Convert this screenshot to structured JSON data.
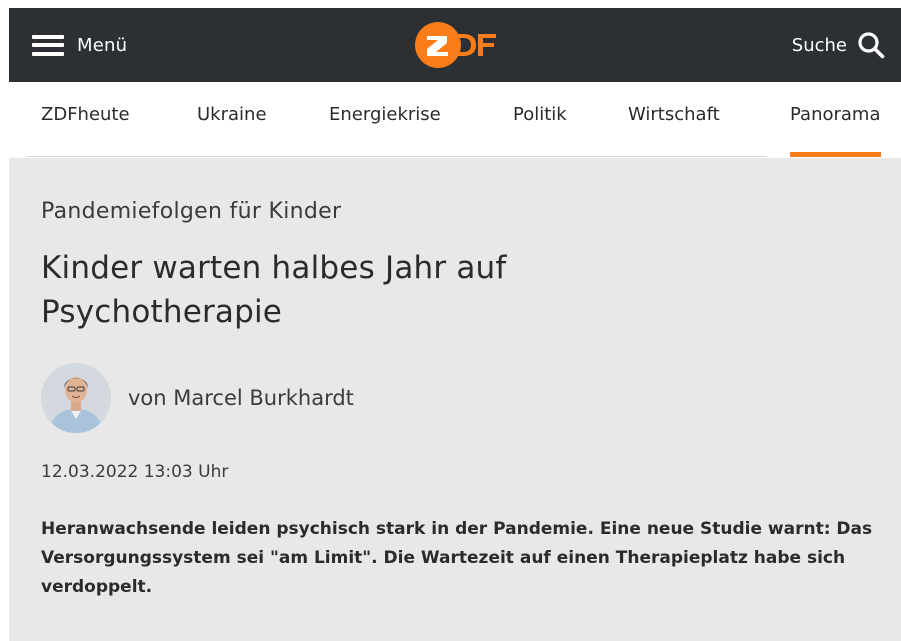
{
  "header": {
    "menu_label": "Menü",
    "logo_text": "ZDF",
    "search_label": "Suche",
    "colors": {
      "bar": "#2c3035",
      "brand": "#fa7d19"
    }
  },
  "nav": {
    "items": [
      {
        "label": "ZDFheute",
        "active": false
      },
      {
        "label": "Ukraine",
        "active": false
      },
      {
        "label": "Energiekrise",
        "active": false
      },
      {
        "label": "Politik",
        "active": false
      },
      {
        "label": "Wirtschaft",
        "active": false
      },
      {
        "label": "Panorama",
        "active": true
      }
    ]
  },
  "article": {
    "kicker": "Pandemiefolgen für Kinder",
    "headline": "Kinder warten halbes Jahr auf Psychotherapie",
    "author": "von Marcel Burkhardt",
    "date": "12.03.2022 13:03 Uhr",
    "lead": "Heranwachsende leiden psychisch stark in der Pandemie. Eine neue Studie warnt: Das Versorgungssystem sei \"am Limit\". Die Wartezeit auf einen Therapieplatz habe sich verdoppelt."
  },
  "icons": [
    "hamburger-icon",
    "zdf-logo",
    "search-icon",
    "author-avatar"
  ]
}
